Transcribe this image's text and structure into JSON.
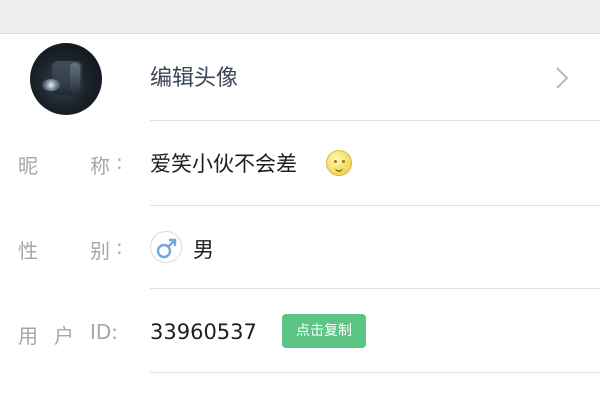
{
  "profile": {
    "edit_avatar_label": "编辑头像",
    "nickname": {
      "label_char1": "昵",
      "label_char2": "称",
      "colon": ":",
      "value": "爱笑小伙不会差"
    },
    "gender": {
      "label_char1": "性",
      "label_char2": "别",
      "colon": ":",
      "icon": "male-symbol-icon",
      "value": "男"
    },
    "user_id": {
      "label_char1": "用",
      "label_char2": "户",
      "label_suffix": "ID:",
      "value": "33960537",
      "copy_button_label": "点击复制"
    }
  },
  "colors": {
    "copy_badge": "#5cc585",
    "label_gray": "#a7a7a7",
    "male_icon_blue": "#6fa8dc"
  }
}
